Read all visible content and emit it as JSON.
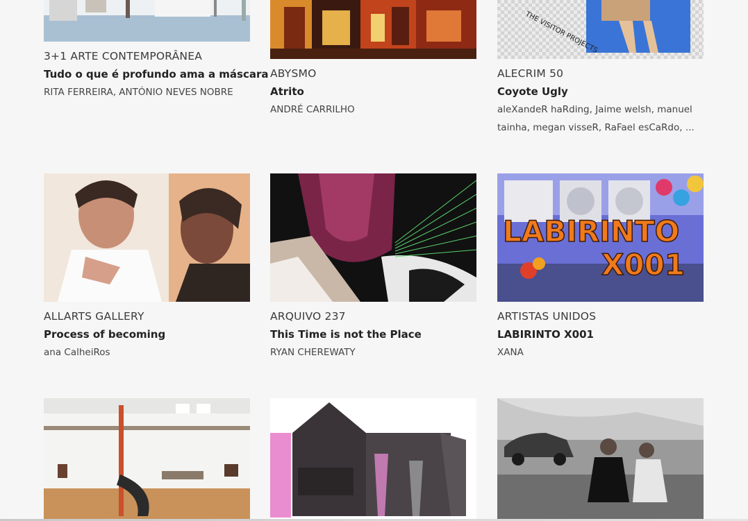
{
  "cards": [
    {
      "venue": "3+1 ARTE CONTEMPORÂNEA",
      "title": "Tudo o que é profundo ama a máscara",
      "artists": "RITA FERREIRA, ANTÓNIO NEVES NOBRE",
      "image": "gallery-interior-photo"
    },
    {
      "venue": "ABYSMO",
      "title": "Atrito",
      "artists": "ANDRÉ CARRILHO",
      "image": "colorful-street-painting"
    },
    {
      "venue": "ALECRIM 50",
      "title": "Coyote Ugly",
      "artists": "aleXandeR haRding, Jaime welsh, manuel tainha, megan visseR, RaFael esCaRdo, ...",
      "image": "the-visitor-projects-collage",
      "image_text": "THE VISITOR PROJECTS"
    },
    {
      "venue": "ALLARTS GALLERY",
      "title": "Process of becoming",
      "artists": "ana CalheiRos",
      "image": "two-figures-painting"
    },
    {
      "venue": "ARQUIVO 237",
      "title": "This Time is not the Place",
      "artists": "RYAN CHEREWATY",
      "image": "glitch-abstract-image"
    },
    {
      "venue": "ARTISTAS UNIDOS",
      "title": "LABIRINTO X001",
      "artists": "XANA",
      "image": "labirinto-poster",
      "image_text_line1": "LABIRINTO",
      "image_text_line2": "X001"
    },
    {
      "venue": "",
      "title": "",
      "artists": "",
      "image": "white-gallery-hall-photo"
    },
    {
      "venue": "",
      "title": "",
      "artists": "",
      "image": "abstract-house-collage"
    },
    {
      "venue": "",
      "title": "",
      "artists": "",
      "image": "black-white-street-photo"
    }
  ],
  "colors": {
    "background": "#f6f6f6",
    "venue_text": "#3a3a3a",
    "title_text": "#222222",
    "artist_text": "#444444",
    "labirinto_orange": "#f07a1c"
  }
}
